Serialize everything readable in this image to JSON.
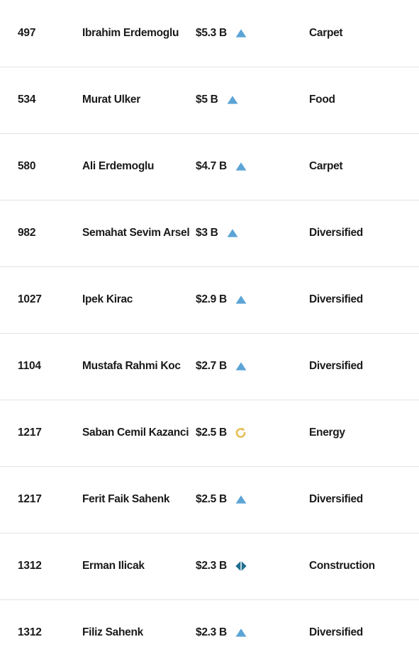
{
  "colors": {
    "up_triangle": "#5ba4d6",
    "flat_diamond": "#1f6f91",
    "returnee_circle": "#e6c15a",
    "text": "#1a1a1a",
    "divider": "#e3e3e3",
    "background": "#ffffff"
  },
  "table": {
    "rows": [
      {
        "rank": "497",
        "name": "Ibrahim Erdemoglu",
        "net_worth": "$5.3 B",
        "change_icon": "up-triangle-icon",
        "industry": "Carpet"
      },
      {
        "rank": "534",
        "name": "Murat Ulker",
        "net_worth": "$5 B",
        "change_icon": "up-triangle-icon",
        "industry": "Food"
      },
      {
        "rank": "580",
        "name": "Ali Erdemoglu",
        "net_worth": "$4.7 B",
        "change_icon": "up-triangle-icon",
        "industry": "Carpet"
      },
      {
        "rank": "982",
        "name": "Semahat Sevim Arsel",
        "net_worth": "$3 B",
        "change_icon": "up-triangle-icon",
        "industry": "Diversified"
      },
      {
        "rank": "1027",
        "name": "Ipek Kirac",
        "net_worth": "$2.9 B",
        "change_icon": "up-triangle-icon",
        "industry": "Diversified"
      },
      {
        "rank": "1104",
        "name": "Mustafa Rahmi Koc",
        "net_worth": "$2.7 B",
        "change_icon": "up-triangle-icon",
        "industry": "Diversified"
      },
      {
        "rank": "1217",
        "name": "Saban Cemil Kazanci",
        "net_worth": "$2.5 B",
        "change_icon": "returnee-circle-arrow-icon",
        "industry": "Energy"
      },
      {
        "rank": "1217",
        "name": "Ferit Faik Sahenk",
        "net_worth": "$2.5 B",
        "change_icon": "up-triangle-icon",
        "industry": "Diversified"
      },
      {
        "rank": "1312",
        "name": "Erman Ilicak",
        "net_worth": "$2.3 B",
        "change_icon": "flat-double-arrow-icon",
        "industry": "Construction"
      },
      {
        "rank": "1312",
        "name": "Filiz Sahenk",
        "net_worth": "$2.3 B",
        "change_icon": "up-triangle-icon",
        "industry": "Diversified"
      }
    ]
  }
}
